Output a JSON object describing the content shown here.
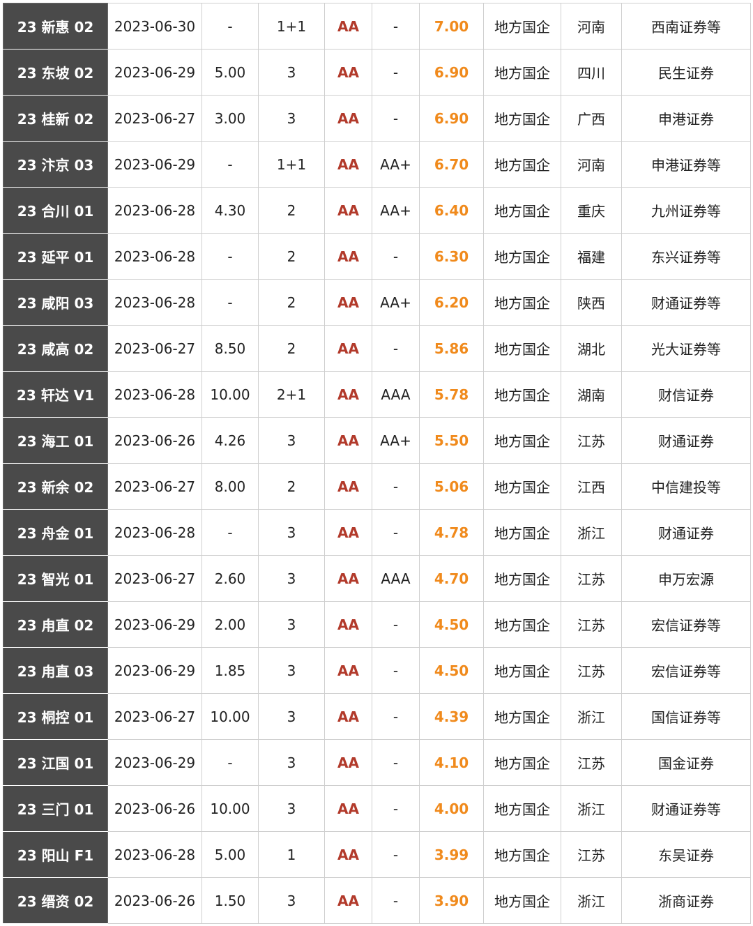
{
  "colors": {
    "name_bg": "#4a4a4a",
    "rating": "#b23a2b",
    "rate": "#f08a1c",
    "border": "#cfcfcf"
  },
  "rows": [
    {
      "name": "23 新惠 02",
      "date": "2023-06-30",
      "amount": "-",
      "term": "1+1",
      "rating": "AA",
      "bond_rating": "-",
      "rate": "7.00",
      "type": "地方国企",
      "region": "河南",
      "underwriter": "西南证券等"
    },
    {
      "name": "23 东坡 02",
      "date": "2023-06-29",
      "amount": "5.00",
      "term": "3",
      "rating": "AA",
      "bond_rating": "-",
      "rate": "6.90",
      "type": "地方国企",
      "region": "四川",
      "underwriter": "民生证券"
    },
    {
      "name": "23 桂新 02",
      "date": "2023-06-27",
      "amount": "3.00",
      "term": "3",
      "rating": "AA",
      "bond_rating": "-",
      "rate": "6.90",
      "type": "地方国企",
      "region": "广西",
      "underwriter": "申港证券"
    },
    {
      "name": "23 汴京 03",
      "date": "2023-06-29",
      "amount": "-",
      "term": "1+1",
      "rating": "AA",
      "bond_rating": "AA+",
      "rate": "6.70",
      "type": "地方国企",
      "region": "河南",
      "underwriter": "申港证券等"
    },
    {
      "name": "23 合川 01",
      "date": "2023-06-28",
      "amount": "4.30",
      "term": "2",
      "rating": "AA",
      "bond_rating": "AA+",
      "rate": "6.40",
      "type": "地方国企",
      "region": "重庆",
      "underwriter": "九州证券等"
    },
    {
      "name": "23 延平 01",
      "date": "2023-06-28",
      "amount": "-",
      "term": "2",
      "rating": "AA",
      "bond_rating": "-",
      "rate": "6.30",
      "type": "地方国企",
      "region": "福建",
      "underwriter": "东兴证券等"
    },
    {
      "name": "23 咸阳 03",
      "date": "2023-06-28",
      "amount": "-",
      "term": "2",
      "rating": "AA",
      "bond_rating": "AA+",
      "rate": "6.20",
      "type": "地方国企",
      "region": "陕西",
      "underwriter": "财通证券等"
    },
    {
      "name": "23 咸高 02",
      "date": "2023-06-27",
      "amount": "8.50",
      "term": "2",
      "rating": "AA",
      "bond_rating": "-",
      "rate": "5.86",
      "type": "地方国企",
      "region": "湖北",
      "underwriter": "光大证券等"
    },
    {
      "name": "23 轩达 V1",
      "date": "2023-06-28",
      "amount": "10.00",
      "term": "2+1",
      "rating": "AA",
      "bond_rating": "AAA",
      "rate": "5.78",
      "type": "地方国企",
      "region": "湖南",
      "underwriter": "财信证券"
    },
    {
      "name": "23 海工 01",
      "date": "2023-06-26",
      "amount": "4.26",
      "term": "3",
      "rating": "AA",
      "bond_rating": "AA+",
      "rate": "5.50",
      "type": "地方国企",
      "region": "江苏",
      "underwriter": "财通证券"
    },
    {
      "name": "23 新余 02",
      "date": "2023-06-27",
      "amount": "8.00",
      "term": "2",
      "rating": "AA",
      "bond_rating": "-",
      "rate": "5.06",
      "type": "地方国企",
      "region": "江西",
      "underwriter": "中信建投等"
    },
    {
      "name": "23 舟金 01",
      "date": "2023-06-28",
      "amount": "-",
      "term": "3",
      "rating": "AA",
      "bond_rating": "-",
      "rate": "4.78",
      "type": "地方国企",
      "region": "浙江",
      "underwriter": "财通证券"
    },
    {
      "name": "23 智光 01",
      "date": "2023-06-27",
      "amount": "2.60",
      "term": "3",
      "rating": "AA",
      "bond_rating": "AAA",
      "rate": "4.70",
      "type": "地方国企",
      "region": "江苏",
      "underwriter": "申万宏源"
    },
    {
      "name": "23 甪直 02",
      "date": "2023-06-29",
      "amount": "2.00",
      "term": "3",
      "rating": "AA",
      "bond_rating": "-",
      "rate": "4.50",
      "type": "地方国企",
      "region": "江苏",
      "underwriter": "宏信证券等"
    },
    {
      "name": "23 甪直 03",
      "date": "2023-06-29",
      "amount": "1.85",
      "term": "3",
      "rating": "AA",
      "bond_rating": "-",
      "rate": "4.50",
      "type": "地方国企",
      "region": "江苏",
      "underwriter": "宏信证券等"
    },
    {
      "name": "23 桐控 01",
      "date": "2023-06-27",
      "amount": "10.00",
      "term": "3",
      "rating": "AA",
      "bond_rating": "-",
      "rate": "4.39",
      "type": "地方国企",
      "region": "浙江",
      "underwriter": "国信证券等"
    },
    {
      "name": "23 江国 01",
      "date": "2023-06-29",
      "amount": "-",
      "term": "3",
      "rating": "AA",
      "bond_rating": "-",
      "rate": "4.10",
      "type": "地方国企",
      "region": "江苏",
      "underwriter": "国金证券"
    },
    {
      "name": "23 三门 01",
      "date": "2023-06-26",
      "amount": "10.00",
      "term": "3",
      "rating": "AA",
      "bond_rating": "-",
      "rate": "4.00",
      "type": "地方国企",
      "region": "浙江",
      "underwriter": "财通证券等"
    },
    {
      "name": "23 阳山 F1",
      "date": "2023-06-28",
      "amount": "5.00",
      "term": "1",
      "rating": "AA",
      "bond_rating": "-",
      "rate": "3.99",
      "type": "地方国企",
      "region": "江苏",
      "underwriter": "东吴证券"
    },
    {
      "name": "23 缙资 02",
      "date": "2023-06-26",
      "amount": "1.50",
      "term": "3",
      "rating": "AA",
      "bond_rating": "-",
      "rate": "3.90",
      "type": "地方国企",
      "region": "浙江",
      "underwriter": "浙商证券"
    }
  ]
}
